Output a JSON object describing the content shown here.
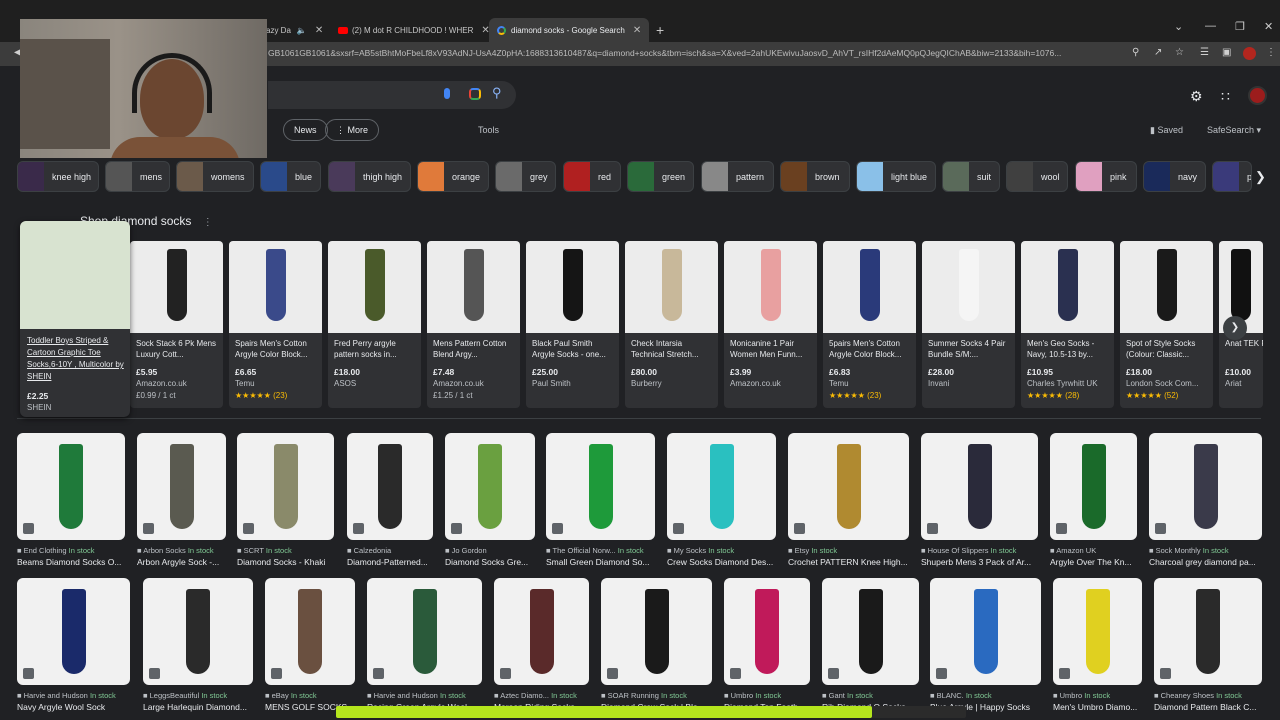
{
  "tabs": [
    {
      "label": "azy Da",
      "muted_icon": "speaker-icon"
    },
    {
      "label": "(2) M dot R CHILDHOOD ! WHER"
    },
    {
      "label": "diamond socks - Google Search"
    }
  ],
  "address": {
    "url": "GB1061GB1061&sxsrf=AB5stBhtMoFbeLf8xV93AdNJ-UsA4Z0pHA:1688313610487&q=diamond+socks&tbm=isch&sa=X&ved=2ahUKEwivuJaosvD_AhVT_rsIHf2dAeMQ0pQJegQIChAB&biw=2133&bih=1076..."
  },
  "nav": {
    "news": "News",
    "more": "⋮ More",
    "tools": "Tools",
    "saved": "Saved",
    "safesearch": "SafeSearch ▾"
  },
  "chips": [
    {
      "label": "knee high",
      "color": "#3a2a4a"
    },
    {
      "label": "mens",
      "color": "#555555"
    },
    {
      "label": "womens",
      "color": "#6b5a4a"
    },
    {
      "label": "blue",
      "color": "#2a4a8a"
    },
    {
      "label": "thigh high",
      "color": "#4a3a5a"
    },
    {
      "label": "orange",
      "color": "#e07a3a"
    },
    {
      "label": "grey",
      "color": "#6a6a6a"
    },
    {
      "label": "red",
      "color": "#b02020"
    },
    {
      "label": "green",
      "color": "#2a6a3a"
    },
    {
      "label": "pattern",
      "color": "#888888"
    },
    {
      "label": "brown",
      "color": "#6a4020"
    },
    {
      "label": "light blue",
      "color": "#8ac0e8"
    },
    {
      "label": "suit",
      "color": "#5a6a5a"
    },
    {
      "label": "wool",
      "color": "#404040"
    },
    {
      "label": "pink",
      "color": "#e0a0c0"
    },
    {
      "label": "navy",
      "color": "#1a2a5a"
    },
    {
      "label": "p",
      "color": "#3a3a7a"
    }
  ],
  "shopping": {
    "title": "Shop diamond socks",
    "hover": {
      "title": "Toddler Boys Striped & Cartoon Graphic Toe Socks,6-10Y , Multicolor by SHEIN",
      "price": "£2.25",
      "store": "SHEIN"
    },
    "cards": [
      {
        "title": "Sock Stack 6 Pk Mens Luxury Cott...",
        "price": "£5.95",
        "store": "Amazon.co.uk",
        "extra": "£0.99 / 1 ct",
        "color": "#222222"
      },
      {
        "title": "Spairs Men's Cotton Argyle Color Block...",
        "price": "£6.65",
        "store": "Temu",
        "extra": "★★★★★ (23)",
        "color": "#3a4a8a"
      },
      {
        "title": "Fred Perry argyle pattern socks in...",
        "price": "£18.00",
        "store": "ASOS",
        "extra": "",
        "color": "#4a5a2a"
      },
      {
        "title": "Mens Pattern Cotton Blend Argy...",
        "price": "£7.48",
        "store": "Amazon.co.uk",
        "extra": "£1.25 / 1 ct",
        "color": "#555555"
      },
      {
        "title": "Black Paul Smith Argyle Socks - one...",
        "price": "£25.00",
        "store": "Paul Smith",
        "extra": "",
        "color": "#151515"
      },
      {
        "title": "Check Intarsia Technical Stretch...",
        "price": "£80.00",
        "store": "Burberry",
        "extra": "",
        "color": "#c8b89a"
      },
      {
        "title": "Monicanine 1 Pair Women Men Funn...",
        "price": "£3.99",
        "store": "Amazon.co.uk",
        "extra": "",
        "color": "#e8a0a0"
      },
      {
        "title": "5pairs Men's Cotton Argyle Color Block...",
        "price": "£6.83",
        "store": "Temu",
        "extra": "★★★★★ (23)",
        "color": "#2a3a7a"
      },
      {
        "title": "Summer Socks 4 Pair Bundle S/M:...",
        "price": "£28.00",
        "store": "Invani",
        "extra": "",
        "color": "#f5f5f5"
      },
      {
        "title": "Men's Geo Socks - Navy, 10.5-13 by...",
        "price": "£10.95",
        "store": "Charles Tyrwhitt UK",
        "extra": "★★★★★ (28)",
        "color": "#2a3050"
      },
      {
        "title": "Spot of Style Socks (Colour: Classic...",
        "price": "£18.00",
        "store": "London Sock Com...",
        "extra": "★★★★★ (52)",
        "color": "#1a1a1a"
      },
      {
        "title": "Anat TEK Performa...",
        "price": "£10.00",
        "store": "Ariat",
        "extra": "",
        "color": "#111111"
      }
    ]
  },
  "grid_row1": [
    {
      "source": "End Clothing",
      "stock": "In stock",
      "title": "Beams Diamond Socks O...",
      "color": "#1f7a3a"
    },
    {
      "source": "Arbon Socks",
      "stock": "In stock",
      "title": "Arbon Argyle Sock -...",
      "color": "#5a5a50"
    },
    {
      "source": "SCRT",
      "stock": "In stock",
      "title": "Diamond Socks - Khaki",
      "color": "#8a8a6a"
    },
    {
      "source": "Calzedonia",
      "stock": "",
      "title": "Diamond-Patterned...",
      "color": "#2a2a2a"
    },
    {
      "source": "Jo Gordon",
      "stock": "",
      "title": "Diamond Socks Gre...",
      "color": "#6aa040"
    },
    {
      "source": "The Official Norw...",
      "stock": "In stock",
      "title": "Small Green Diamond So...",
      "color": "#1e9a3a"
    },
    {
      "source": "My Socks",
      "stock": "In stock",
      "title": "Crew Socks Diamond Des...",
      "color": "#2ac0c0"
    },
    {
      "source": "Etsy",
      "stock": "In stock",
      "title": "Crochet PATTERN Knee High...",
      "color": "#b08a30"
    },
    {
      "source": "House Of Slippers",
      "stock": "In stock",
      "title": "Shuperb Mens 3 Pack of Ar...",
      "color": "#2a2a3a"
    },
    {
      "source": "Amazon UK",
      "stock": "",
      "title": "Argyle Over The Kn...",
      "color": "#1a6a2a"
    },
    {
      "source": "Sock Monthly",
      "stock": "In stock",
      "title": "Charcoal grey diamond pa...",
      "color": "#3a3a4a"
    }
  ],
  "grid_row2": [
    {
      "source": "Harvie and Hudson",
      "stock": "In stock",
      "title": "Navy Argyle Wool Sock",
      "color": "#1a2a6a"
    },
    {
      "source": "LeggsBeautiful",
      "stock": "In stock",
      "title": "Large Harlequin Diamond...",
      "color": "#2a2a2a"
    },
    {
      "source": "eBay",
      "stock": "In stock",
      "title": "MENS GOLF SOCKS...",
      "color": "#6a5040"
    },
    {
      "source": "Harvie and Hudson",
      "stock": "In stock",
      "title": "Racing Green Argyle Wool...",
      "color": "#2a5a3a"
    },
    {
      "source": "Aztec Diamo...",
      "stock": "In stock",
      "title": "Maroon Riding Socks...",
      "color": "#5a2a2a"
    },
    {
      "source": "SOAR Running",
      "stock": "In stock",
      "title": "Diamond Crew Sock | Bla...",
      "color": "#1a1a1a"
    },
    {
      "source": "Umbro",
      "stock": "In stock",
      "title": "Diamond Top Footb...",
      "color": "#c01a5a"
    },
    {
      "source": "Gant",
      "stock": "In stock",
      "title": "Rib Diamond O Socks",
      "color": "#1a1a1a"
    },
    {
      "source": "BLANC.",
      "stock": "In stock",
      "title": "Blue Argyle | Happy Socks",
      "color": "#2a6ac0"
    },
    {
      "source": "Umbro",
      "stock": "In stock",
      "title": "Men's Umbro Diamo...",
      "color": "#e0d020"
    },
    {
      "source": "Cheaney Shoes",
      "stock": "In stock",
      "title": "Diamond Pattern Black C...",
      "color": "#2a2a2a"
    }
  ],
  "video_progress": 0.85
}
